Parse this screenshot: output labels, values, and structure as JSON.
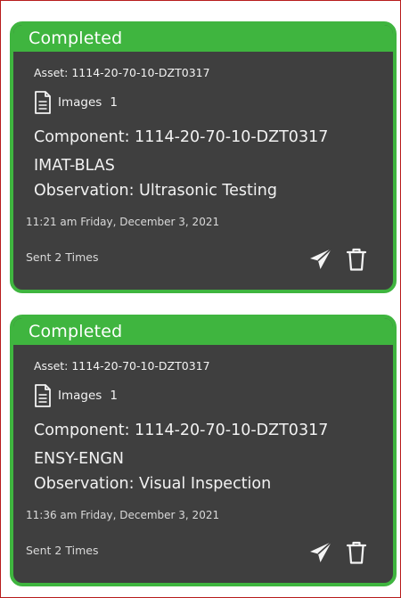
{
  "colors": {
    "card_background": "#3f3f3f",
    "accent_green": "#3fb53f",
    "text": "#f2f2f2",
    "frame_border": "#b71c1c"
  },
  "cards": [
    {
      "status": "Completed",
      "asset": "Asset: 1114-20-70-10-DZT0317",
      "images_label": "Images",
      "images_count": "1",
      "component_line1": "Component: 1114-20-70-10-DZT0317",
      "component_line2": "IMAT-BLAS",
      "observation": "Observation: Ultrasonic Testing",
      "timestamp": "11:21 am Friday, December 3, 2021",
      "sent_count": "Sent 2 Times",
      "icons": [
        "document-icon",
        "send-icon",
        "trash-icon"
      ]
    },
    {
      "status": "Completed",
      "asset": "Asset: 1114-20-70-10-DZT0317",
      "images_label": "Images",
      "images_count": "1",
      "component_line1": "Component: 1114-20-70-10-DZT0317",
      "component_line2": "ENSY-ENGN",
      "observation": "Observation: Visual Inspection",
      "timestamp": "11:36 am Friday, December 3, 2021",
      "sent_count": "Sent 2 Times",
      "icons": [
        "document-icon",
        "send-icon",
        "trash-icon"
      ]
    }
  ]
}
